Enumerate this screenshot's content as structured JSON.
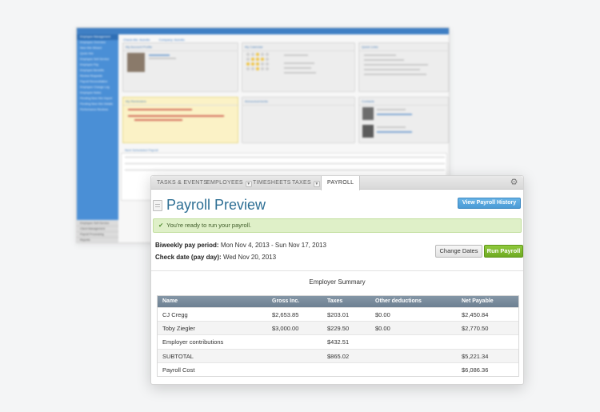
{
  "background_dashboard": {
    "breadcrumb": [
      "Check-Me: Acevito",
      "Company: Acevito"
    ],
    "sidebar_items": [
      "Employee Management",
      "Employee Overview",
      "New Hire Wizard",
      "Quick Hire",
      "Employee Self-Service",
      "Employee Pay",
      "Employee Benefits",
      "Review Requests",
      "Payroll Reconciliation",
      "Employee Change Log",
      "Employee Notes",
      "Pending New Hire Import",
      "Pending New Hire Details",
      "Performance Reviews"
    ],
    "sidebar_bottom_items": [
      "Employee Self-Service",
      "Client Management",
      "Payroll Processing",
      "Reports"
    ],
    "panels": {
      "profile": "My Account Profile",
      "calendar": "My Calendar",
      "quick_links": "Quick Links",
      "reminders": "My Reminders",
      "announcements": "Announcements",
      "contacts": "Contacts",
      "next_payroll": "Next Scheduled Payroll"
    }
  },
  "tabs": [
    {
      "label": "TASKS & EVENTS",
      "has_menu": false,
      "active": false
    },
    {
      "label": "EMPLOYEES",
      "has_menu": true,
      "active": false
    },
    {
      "label": "TIMESHEETS",
      "has_menu": false,
      "active": false
    },
    {
      "label": "TAXES",
      "has_menu": true,
      "active": false
    },
    {
      "label": "PAYROLL",
      "has_menu": false,
      "active": true
    }
  ],
  "icons": {
    "settings": "gear-icon",
    "document": "document-icon",
    "check": "checkmark-icon"
  },
  "header": {
    "title": "Payroll Preview",
    "history_button": "View Payroll History"
  },
  "alert": {
    "message": "You're ready to run your payroll."
  },
  "pay_period": {
    "label": "Biweekly pay period:",
    "value": "Mon Nov 4, 2013 - Sun Nov 17, 2013"
  },
  "check_date": {
    "label": "Check date (pay day):",
    "value": "Wed Nov 20, 2013"
  },
  "actions": {
    "change_dates": "Change Dates",
    "run_payroll": "Run Payroll"
  },
  "summary": {
    "title": "Employer Summary",
    "columns": [
      "Name",
      "Gross Inc.",
      "Taxes",
      "Other deductions",
      "Net Payable"
    ],
    "rows": [
      [
        "CJ Cregg",
        "$2,653.85",
        "$203.01",
        "$0.00",
        "$2,450.84"
      ],
      [
        "Toby Ziegler",
        "$3,000.00",
        "$229.50",
        "$0.00",
        "$2,770.50"
      ],
      [
        "Employer contributions",
        "",
        "$432.51",
        "",
        ""
      ],
      [
        "SUBTOTAL",
        "",
        "$865.02",
        "",
        "$5,221.34"
      ],
      [
        "Payroll Cost",
        "",
        "",
        "",
        "$6,086.36"
      ]
    ]
  },
  "colors": {
    "title": "#2e6f94",
    "run_button": "#7bb52c",
    "history_button": "#4a9bd6",
    "alert_bg": "#dff0c8",
    "table_header": "#778a9b"
  }
}
